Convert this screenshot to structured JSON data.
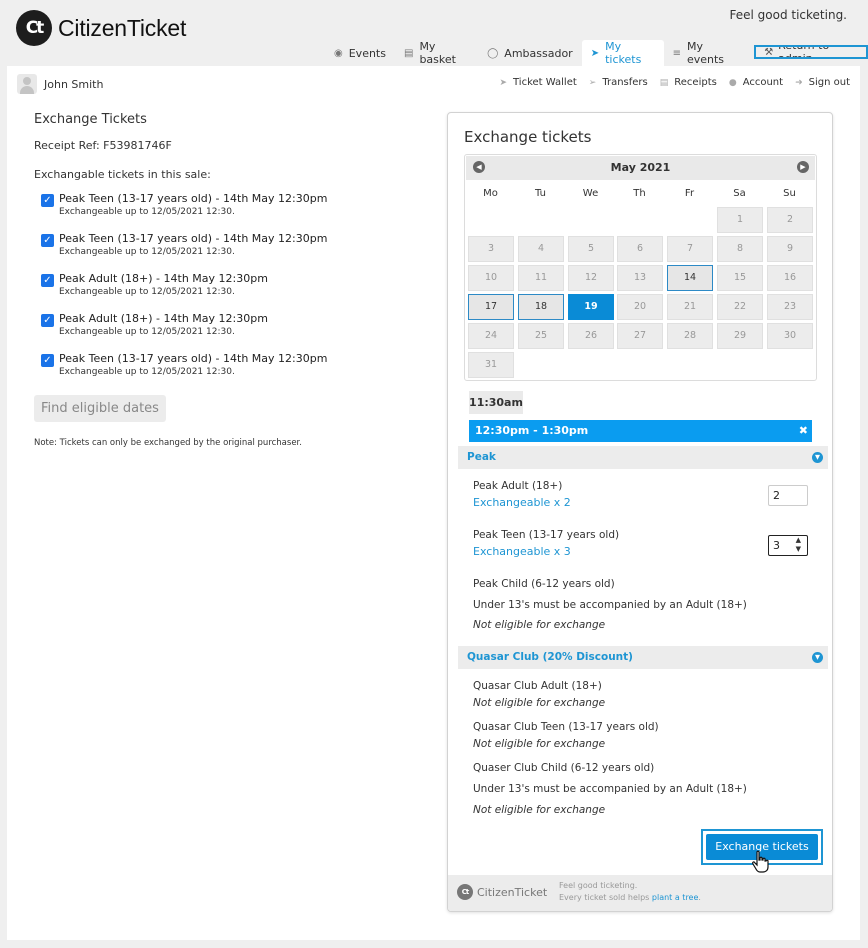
{
  "brand": {
    "logo_mark": "Ct",
    "name": "CitizenTicket",
    "tagline": "Feel good ticketing."
  },
  "topnav": [
    {
      "label": "Events",
      "icon": "tag-icon"
    },
    {
      "label": "My basket",
      "icon": "basket-icon"
    },
    {
      "label": "Ambassador",
      "icon": "shield-icon"
    },
    {
      "label": "My tickets",
      "icon": "ticket-icon",
      "active": true
    },
    {
      "label": "My events",
      "icon": "sliders-icon"
    }
  ],
  "return_admin": "Return to admin",
  "user": {
    "name": "John Smith"
  },
  "account_nav": [
    "Ticket Wallet",
    "Transfers",
    "Receipts",
    "Account",
    "Sign out"
  ],
  "left": {
    "title": "Exchange Tickets",
    "receipt": "Receipt Ref: F53981746F",
    "intro": "Exchangable tickets in this sale:",
    "tickets": [
      {
        "name": "Peak Teen (13-17 years old) - 14th May 12:30pm",
        "sub": "Exchangeable up to 12/05/2021 12:30.",
        "checked": true
      },
      {
        "name": "Peak Teen (13-17 years old) - 14th May 12:30pm",
        "sub": "Exchangeable up to 12/05/2021 12:30.",
        "checked": true
      },
      {
        "name": "Peak Adult (18+) - 14th May 12:30pm",
        "sub": "Exchangeable up to 12/05/2021 12:30.",
        "checked": true
      },
      {
        "name": "Peak Adult (18+) - 14th May 12:30pm",
        "sub": "Exchangeable up to 12/05/2021 12:30.",
        "checked": true
      },
      {
        "name": "Peak Teen (13-17 years old) - 14th May 12:30pm",
        "sub": "Exchangeable up to 12/05/2021 12:30.",
        "checked": true
      }
    ],
    "find_button": "Find eligible dates",
    "note": "Note: Tickets can only be exchanged by the original purchaser."
  },
  "card": {
    "title": "Exchange tickets",
    "calendar": {
      "month": "May 2021",
      "weekdays": [
        "Mo",
        "Tu",
        "We",
        "Th",
        "Fr",
        "Sa",
        "Su"
      ],
      "first_weekday_index": 5,
      "days_in_month": 31,
      "current_day": 14,
      "available_days": [
        17,
        18
      ],
      "muted_outline_days": [
        18
      ],
      "selected_day": 19
    },
    "times": {
      "first": "11:30am",
      "selected": "12:30pm - 1:30pm",
      "clear": "✖"
    },
    "peak": {
      "title": "Peak",
      "adult_label": "Peak Adult (18+)",
      "adult_exch": "Exchangeable x 2",
      "adult_qty": "2",
      "teen_label": "Peak Teen (13-17 years old)",
      "teen_exch": "Exchangeable x 3",
      "teen_qty": "3",
      "child_label": "Peak Child (6-12 years old)",
      "child_note": "Under 13's must be accompanied by an Adult (18+)",
      "child_status": "Not eligible for exchange"
    },
    "quasar": {
      "title": "Quasar Club (20% Discount)",
      "adult_label": "Quasar Club Adult (18+)",
      "adult_status": "Not eligible for exchange",
      "teen_label": "Quasar Club Teen (13-17 years old)",
      "teen_status": "Not eligible for exchange",
      "child_label": "Quaser Club Child (6-12 years old)",
      "child_note": "Under 13's must be accompanied by an Adult (18+)",
      "child_status": "Not eligible for exchange"
    },
    "exchange_button": "Exchange tickets",
    "footer": {
      "logo_mark": "Ct",
      "name": "CitizenTicket",
      "tag1": "Feel good ticketing.",
      "tag2_prefix": "Every ticket sold helps ",
      "tag2_link": "plant a tree",
      "tag2_suffix": "."
    }
  }
}
